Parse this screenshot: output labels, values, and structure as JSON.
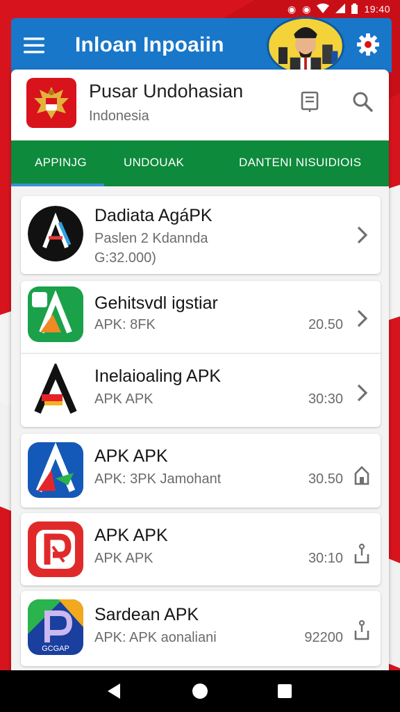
{
  "status_bar": {
    "time": "19:40",
    "icons": [
      "notification-icon",
      "notification-icon",
      "wifi-icon",
      "signal-icon",
      "battery-icon"
    ]
  },
  "app_bar": {
    "title": "Inloan Inpoaiin",
    "menu_icon": "hamburger-menu-icon",
    "avatar": "user-avatar",
    "settings_icon": "gear-icon",
    "color": "#1877c9"
  },
  "header": {
    "title": "Pusar Undohasian",
    "subtitle": "Indonesia",
    "emblem": "garuda-emblem-icon",
    "actions": [
      "document-icon",
      "search-icon"
    ]
  },
  "tabs": [
    {
      "label": "APPINJG"
    },
    {
      "label": "UNDOUAK"
    },
    {
      "label": "DANTENI NISUIDIOIS"
    }
  ],
  "tabs_color": "#0d8a3b",
  "apps": [
    {
      "name": "Dadiata AgáPK",
      "desc": "Paslen 2 Kdannda",
      "size": "G:32.000)",
      "version": "",
      "icon": "dark-circle-a-icon",
      "action": "chevron-right-icon"
    },
    {
      "name": "Gehitsvdl igstiar",
      "desc": "APK: 8FK",
      "size": "",
      "version": "20.50",
      "icon": "green-a-icon",
      "action": "chevron-right-icon"
    },
    {
      "name": "Inelaioaling APK",
      "desc": "APK APK",
      "size": "",
      "version": "30:30",
      "icon": "black-a-icon",
      "action": "chevron-right-icon"
    },
    {
      "name": "APK APK",
      "desc": "APK: 3PK Jamohant",
      "size": "",
      "version": "30.50",
      "icon": "blue-a-icon",
      "action": "install-icon"
    },
    {
      "name": "APK APK",
      "desc": "APK APK",
      "size": "",
      "version": "30:10",
      "icon": "red-p-icon",
      "action": "download-icon"
    },
    {
      "name": "Sardean APK",
      "desc": "APK: APK aonaliani",
      "size": "",
      "version": "92200",
      "icon": "multicolor-p-icon",
      "action": "download-icon"
    }
  ],
  "nav_bar": {
    "buttons": [
      "back-icon",
      "home-icon",
      "recents-icon"
    ]
  }
}
